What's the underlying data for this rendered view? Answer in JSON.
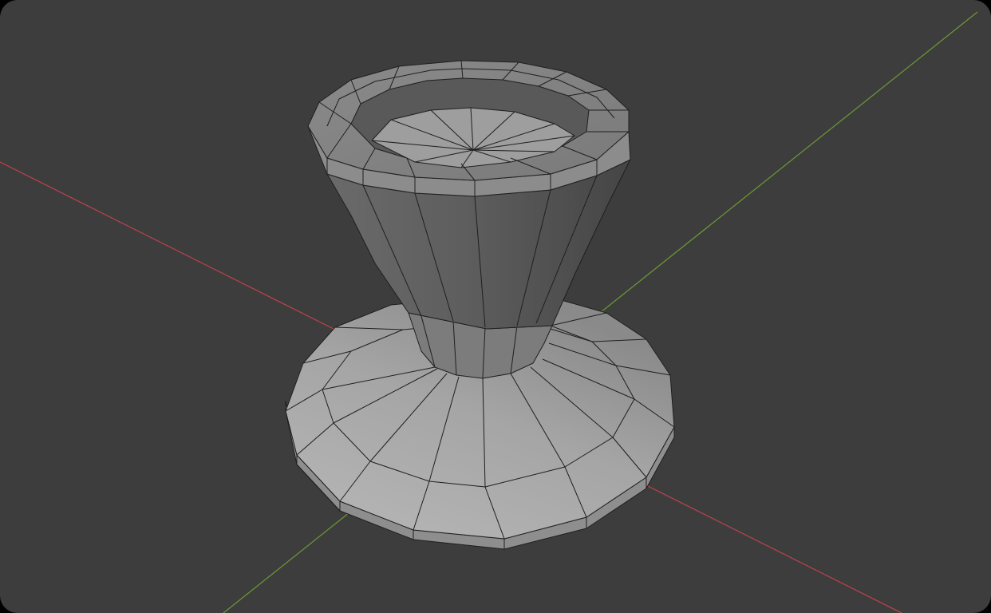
{
  "viewport": {
    "background_color": "#3d3d3d",
    "x_axis_color": "#c0434d",
    "y_axis_color": "#6e9a35",
    "wireframe_color": "#1f1f1f",
    "object_face_colors": {
      "light": "#b5b5b5",
      "mid": "#9a9a9a",
      "dark": "#5a5a5a"
    },
    "object_description_icon": "vase-mesh-icon"
  }
}
